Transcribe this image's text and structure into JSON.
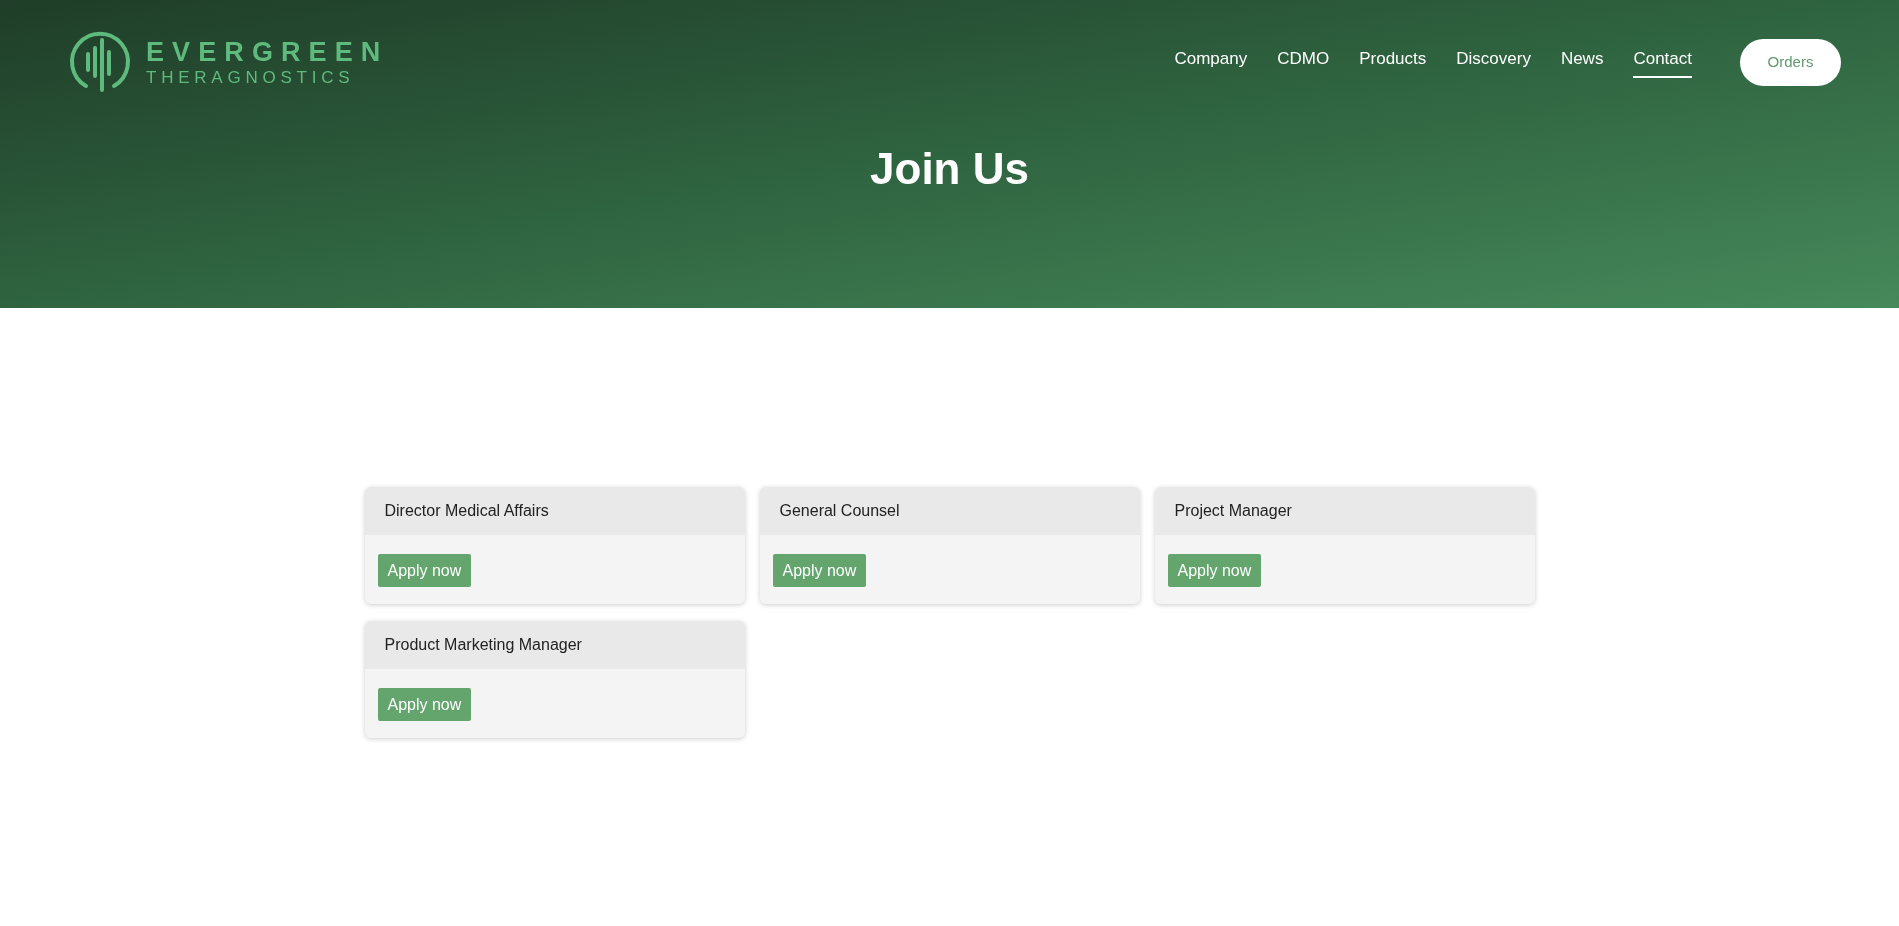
{
  "logo": {
    "name": "EVERGREEN",
    "subtitle": "THERAGNOSTICS"
  },
  "nav": [
    {
      "label": "Company",
      "selected": false
    },
    {
      "label": "CDMO",
      "selected": false
    },
    {
      "label": "Products",
      "selected": false
    },
    {
      "label": "Discovery",
      "selected": false
    },
    {
      "label": "News",
      "selected": false
    },
    {
      "label": "Contact",
      "selected": true
    }
  ],
  "orders_button": "Orders",
  "hero": {
    "title": "Join Us"
  },
  "jobs": [
    {
      "title": "Director Medical Affairs",
      "button": "Apply now"
    },
    {
      "title": "General Counsel",
      "button": "Apply now"
    },
    {
      "title": "Project Manager",
      "button": "Apply now"
    },
    {
      "title": "Product Marketing Manager",
      "button": "Apply now"
    }
  ]
}
